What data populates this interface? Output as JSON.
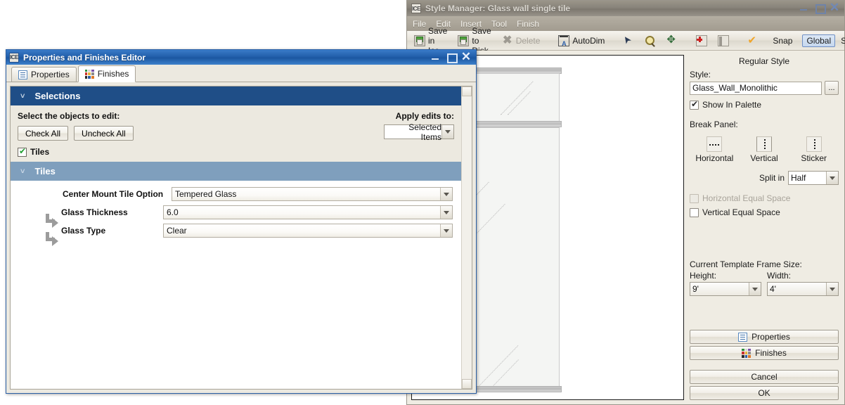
{
  "style_manager": {
    "title": "Style Manager: Glass wall single tile",
    "title_icon": "ice-app-icon",
    "window_buttons": {
      "minimize": "–",
      "maximize": "□",
      "close": "✕"
    },
    "menu": [
      "File",
      "Edit",
      "Insert",
      "Tool",
      "Finish"
    ],
    "toolbar": {
      "save_in_ice": "Save in Ice",
      "save_to_disk": "Save to Disk",
      "delete": "Delete",
      "autodim": "AutoDim",
      "snap": "Snap",
      "global": "Global",
      "style": "Style"
    },
    "right_panel": {
      "heading": "Regular Style",
      "style_label": "Style:",
      "style_value": "Glass_Wall_Monolithic",
      "browse_label": "...",
      "show_in_palette": "Show In Palette",
      "show_in_palette_checked": true,
      "break_panel_label": "Break Panel:",
      "break_panel_items": [
        {
          "label": "Horizontal",
          "icon": "break-horizontal-icon"
        },
        {
          "label": "Vertical",
          "icon": "break-vertical-icon"
        },
        {
          "label": "Sticker",
          "icon": "break-sticker-icon"
        }
      ],
      "split_in_label": "Split in",
      "split_in_value": "Half",
      "horizontal_equal_space": "Horizontal Equal Space",
      "horizontal_equal_space_checked": false,
      "horizontal_equal_space_disabled": true,
      "vertical_equal_space": "Vertical Equal Space",
      "vertical_equal_space_checked": false,
      "frame_size_label": "Current Template Frame Size:",
      "height_label": "Height:",
      "height_value": "9'",
      "width_label": "Width:",
      "width_value": "4'",
      "properties_button": "Properties",
      "finishes_button": "Finishes",
      "cancel_button": "Cancel",
      "ok_button": "OK"
    }
  },
  "properties_editor": {
    "title": "Properties and Finishes Editor",
    "title_icon": "ice-app-icon",
    "window_buttons": {
      "minimize": "–",
      "maximize": "□",
      "close": "✕"
    },
    "tabs": [
      {
        "label": "Properties",
        "icon": "list-icon",
        "active": false
      },
      {
        "label": "Finishes",
        "icon": "swatch-grid-icon",
        "active": true
      }
    ],
    "selections": {
      "header": "Selections",
      "prompt": "Select the objects to edit:",
      "check_all": "Check All",
      "uncheck_all": "Uncheck All",
      "apply_edits_label": "Apply edits to:",
      "apply_edits_value": "Selected Items",
      "tiles_checkbox_label": "Tiles",
      "tiles_checked": true
    },
    "tiles": {
      "header": "Tiles",
      "fields": [
        {
          "label": "Center Mount Tile Option",
          "value": "Tempered Glass",
          "indented": false
        },
        {
          "label": "Glass Thickness",
          "value": "6.0",
          "indented": true
        },
        {
          "label": "Glass Type",
          "value": "Clear",
          "indented": true
        }
      ]
    }
  },
  "colors": {
    "titlebar_active": "#1f5ca8",
    "titlebar_inactive": "#88837a",
    "section_header_dark": "#1f4e87",
    "section_header_light": "#7f9fbd",
    "panel_bg": "#ece9e0",
    "accent_blue": "#2a5fa5",
    "check_green": "#1f9e30"
  }
}
